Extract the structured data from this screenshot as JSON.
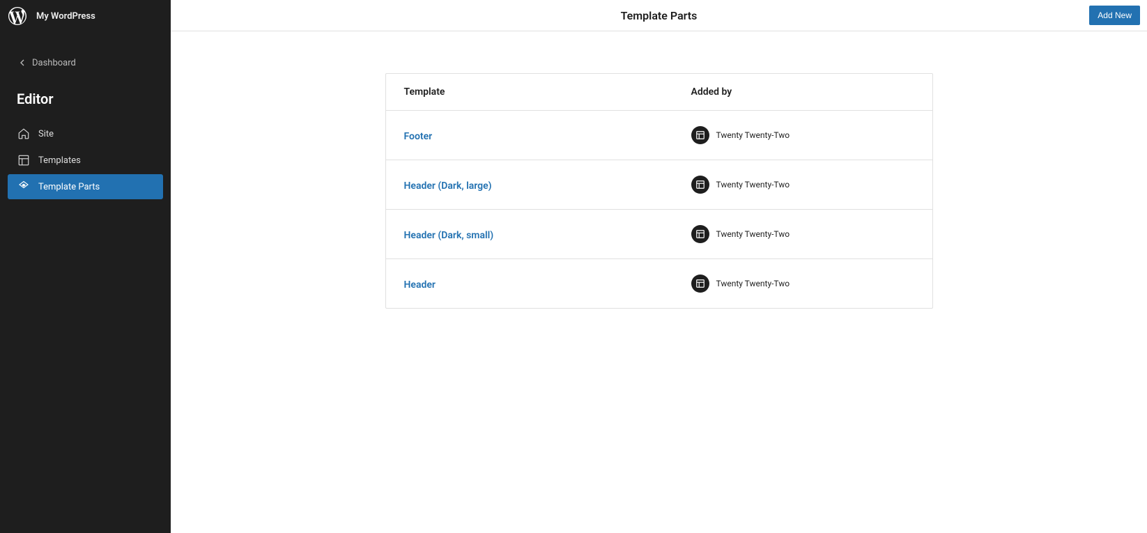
{
  "sidebar": {
    "site_title": "My WordPress",
    "dashboard_label": "Dashboard",
    "editor_title": "Editor",
    "nav": [
      {
        "label": "Site",
        "active": false
      },
      {
        "label": "Templates",
        "active": false
      },
      {
        "label": "Template Parts",
        "active": true
      }
    ]
  },
  "header": {
    "title": "Template Parts",
    "add_new_label": "Add New"
  },
  "table": {
    "columns": {
      "template": "Template",
      "added_by": "Added by"
    },
    "rows": [
      {
        "template": "Footer",
        "added_by": "Twenty Twenty-Two"
      },
      {
        "template": "Header (Dark, large)",
        "added_by": "Twenty Twenty-Two"
      },
      {
        "template": "Header (Dark, small)",
        "added_by": "Twenty Twenty-Two"
      },
      {
        "template": "Header",
        "added_by": "Twenty Twenty-Two"
      }
    ]
  }
}
